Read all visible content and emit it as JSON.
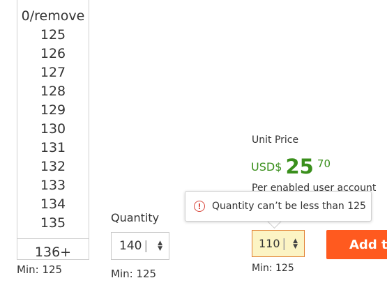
{
  "dropdown": {
    "items": [
      "0/remove",
      "125",
      "126",
      "127",
      "128",
      "129",
      "130",
      "131",
      "132",
      "133",
      "134",
      "135"
    ],
    "last_item": "136+",
    "min_label": "Min: 125"
  },
  "quantity": {
    "label": "Quantity",
    "value": "140",
    "min_label": "Min: 125"
  },
  "pricing": {
    "unit_price_label": "Unit Price",
    "currency": "USD$",
    "whole": "25",
    "cents": "70",
    "per_account": "Per enabled user account"
  },
  "tooltip": {
    "message": "Quantity can’t be less than 125"
  },
  "quantity_error": {
    "value": "110",
    "min_label": "Min: 125"
  },
  "add_button": {
    "label": "Add to Cart"
  },
  "colors": {
    "price_green": "#3a8f1c",
    "error_red": "#d9463b",
    "error_field_bg": "#fcf4c4",
    "button_orange": "#ff5a1f"
  },
  "icons": {
    "error": "exclamation-circle-icon",
    "stepper": "up-down-arrows-icon"
  }
}
